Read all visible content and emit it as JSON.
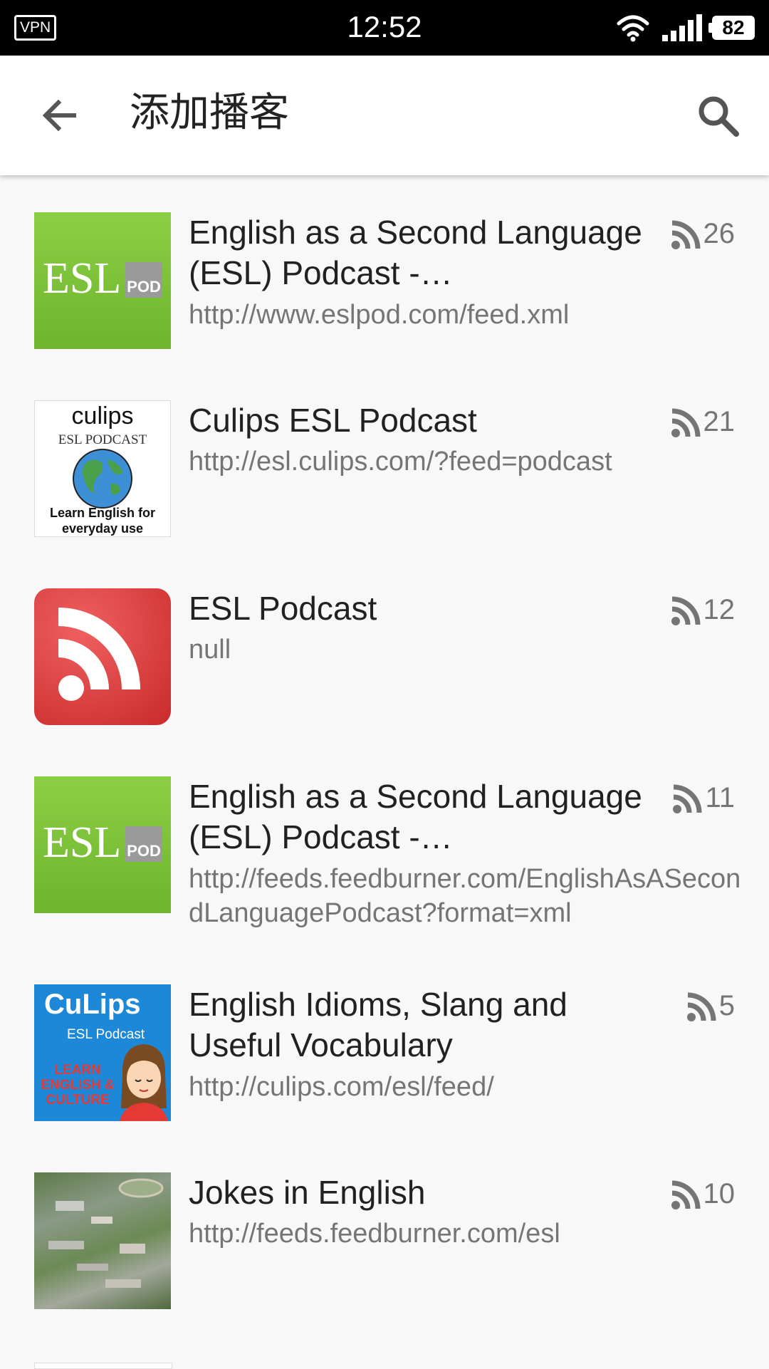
{
  "status_bar": {
    "vpn": "VPN",
    "time": "12:52",
    "battery": "82"
  },
  "app_bar": {
    "title": "添加播客"
  },
  "podcasts": [
    {
      "title": "English as a Second Language (ESL) Podcast -…",
      "url": "http://www.eslpod.com/feed.xml",
      "count": "26",
      "thumb": "eslpod"
    },
    {
      "title": "Culips ESL Podcast",
      "url": "http://esl.culips.com/?feed=podcast",
      "count": "21",
      "thumb": "culips-globe"
    },
    {
      "title": "ESL Podcast",
      "url": "null",
      "count": "12",
      "thumb": "rss-red"
    },
    {
      "title": "English as a Second Language (ESL) Podcast -…",
      "url": "http://feeds.feedburner.com/EnglishAsASecondLanguagePodcast?format=xml",
      "count": "11",
      "thumb": "eslpod"
    },
    {
      "title": "English Idioms, Slang and Useful Vocabulary",
      "url": "http://culips.com/esl/feed/",
      "count": "5",
      "thumb": "culips-blue"
    },
    {
      "title": "Jokes in English",
      "url": "http://feeds.feedburner.com/esl",
      "count": "10",
      "thumb": "aerial-photo"
    }
  ],
  "thumb_text": {
    "eslpod_big": "ESL",
    "eslpod_small": "POD",
    "culips_top": "culips",
    "culips_sub": "ESL PODCAST",
    "culips_bottom": "Learn English for everyday use",
    "culips_blue_logo": "CuLips",
    "culips_blue_sub": "ESL Podcast",
    "culips_blue_text": "LEARN ENGLISH & CULTURE"
  },
  "colors": {
    "esl_green": "#7cc13a",
    "rss_red": "#d93a3a",
    "culips_blue": "#1e88d8",
    "text_primary": "#212121",
    "text_secondary": "#757575"
  }
}
